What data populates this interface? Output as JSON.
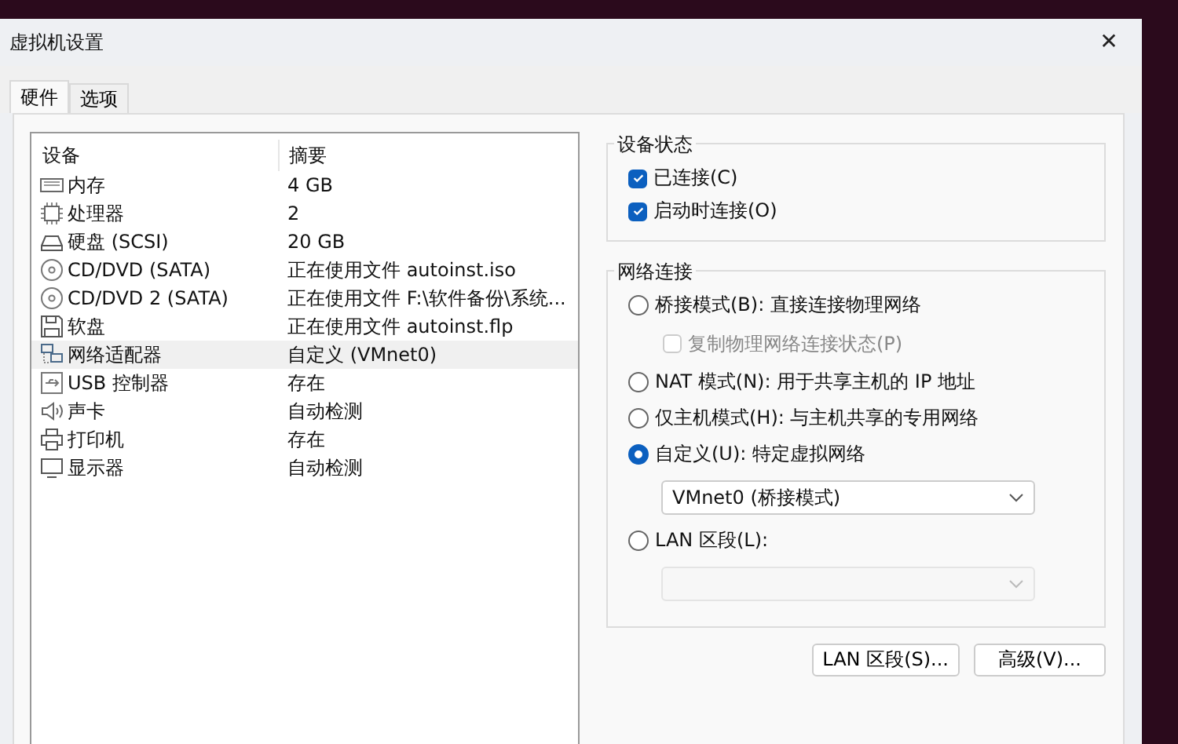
{
  "window": {
    "title": "虚拟机设置",
    "close": "✕"
  },
  "tabs": [
    {
      "label": "硬件",
      "selected": true
    },
    {
      "label": "选项",
      "selected": false
    }
  ],
  "devices": {
    "columns": [
      "设备",
      "摘要"
    ],
    "rows": [
      {
        "kind": "memory",
        "device": "内存",
        "summary": "4 GB",
        "selected": false
      },
      {
        "kind": "cpu",
        "device": "处理器",
        "summary": "2",
        "selected": false
      },
      {
        "kind": "disk",
        "device": "硬盘 (SCSI)",
        "summary": "20 GB",
        "selected": false
      },
      {
        "kind": "cd",
        "device": "CD/DVD (SATA)",
        "summary": "正在使用文件 autoinst.iso",
        "selected": false
      },
      {
        "kind": "cd",
        "device": "CD/DVD 2 (SATA)",
        "summary": "正在使用文件 F:\\软件备份\\系统...",
        "selected": false
      },
      {
        "kind": "floppy",
        "device": "软盘",
        "summary": "正在使用文件 autoinst.flp",
        "selected": false
      },
      {
        "kind": "network",
        "device": "网络适配器",
        "summary": "自定义 (VMnet0)",
        "selected": true
      },
      {
        "kind": "usb",
        "device": "USB 控制器",
        "summary": "存在",
        "selected": false
      },
      {
        "kind": "sound",
        "device": "声卡",
        "summary": "自动检测",
        "selected": false
      },
      {
        "kind": "printer",
        "device": "打印机",
        "summary": "存在",
        "selected": false
      },
      {
        "kind": "display",
        "device": "显示器",
        "summary": "自动检测",
        "selected": false
      }
    ]
  },
  "device_status": {
    "title": "设备状态",
    "options": [
      {
        "label": "已连接(C)",
        "checked": true
      },
      {
        "label": "启动时连接(O)",
        "checked": true
      }
    ]
  },
  "network_connection": {
    "title": "网络连接",
    "items": [
      {
        "kind": "radio",
        "label": "桥接模式(B): 直接连接物理网络",
        "selected": false
      },
      {
        "kind": "checkbox",
        "label": "复制物理网络连接状态(P)",
        "checked": false,
        "disabled": true
      },
      {
        "kind": "radio",
        "label": "NAT 模式(N): 用于共享主机的 IP 地址",
        "selected": false
      },
      {
        "kind": "radio",
        "label": "仅主机模式(H): 与主机共享的专用网络",
        "selected": false
      },
      {
        "kind": "radio",
        "label": "自定义(U): 特定虚拟网络",
        "selected": true
      },
      {
        "kind": "select",
        "value": "VMnet0 (桥接模式)",
        "disabled": false
      },
      {
        "kind": "radio",
        "label": "LAN 区段(L):",
        "selected": false
      },
      {
        "kind": "select",
        "disabled": true
      }
    ]
  },
  "buttons": [
    "LAN 区段(S)...",
    "高级(V)..."
  ]
}
